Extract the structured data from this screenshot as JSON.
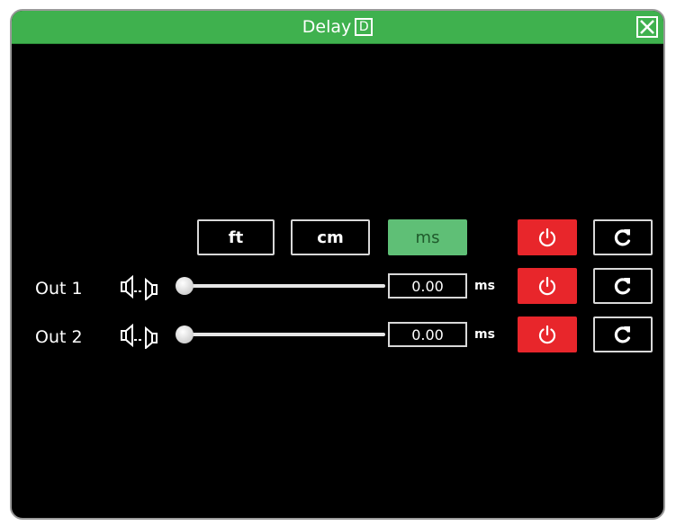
{
  "window": {
    "title": "Delay",
    "title_badge": "D",
    "titlebar_color": "#3fb14e"
  },
  "units": {
    "buttons": [
      {
        "label": "ft",
        "active": false
      },
      {
        "label": "cm",
        "active": false
      },
      {
        "label": "ms",
        "active": true
      }
    ]
  },
  "outputs": [
    {
      "label": "Out 1",
      "value": "0.00",
      "unit": "ms",
      "slider_fraction": 0
    },
    {
      "label": "Out 2",
      "value": "0.00",
      "unit": "ms",
      "slider_fraction": 0
    }
  ],
  "colors": {
    "power_on": "#e8262b",
    "active_unit": "#5fbf76"
  },
  "icons": {
    "power": "power-icon",
    "reset": "refresh-icon",
    "speaker": "speaker-link-icon",
    "close": "close-icon"
  }
}
